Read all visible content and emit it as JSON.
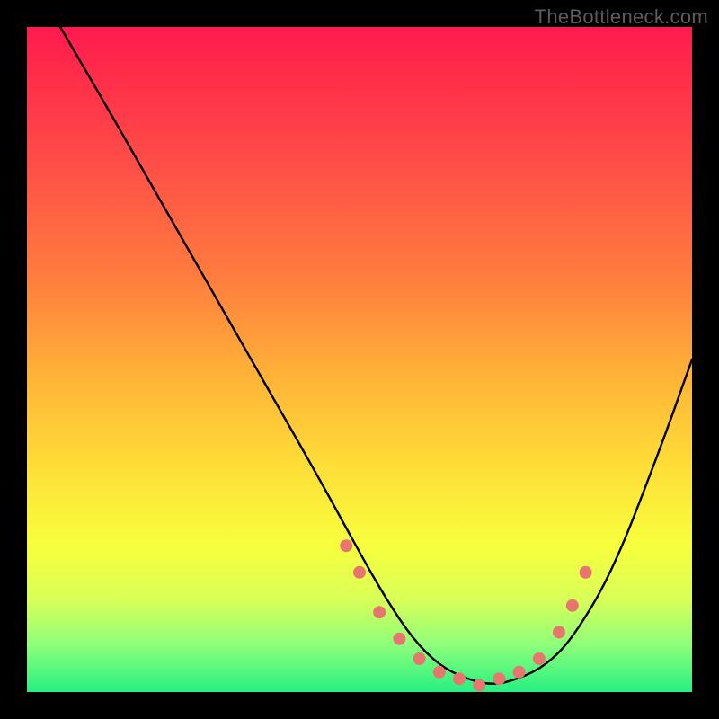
{
  "watermark": "TheBottleneck.com",
  "chart_data": {
    "type": "line",
    "title": "",
    "xlabel": "",
    "ylabel": "",
    "ylim": [
      0,
      100
    ],
    "xlim": [
      0,
      100
    ],
    "series": [
      {
        "name": "bottleneck-curve",
        "x": [
          5,
          12,
          20,
          28,
          36,
          44,
          50,
          54,
          58,
          62,
          66,
          70,
          74,
          78,
          82,
          88,
          95,
          100
        ],
        "y": [
          100,
          88,
          74,
          60,
          46,
          32,
          21,
          14,
          8,
          4,
          2,
          1,
          2,
          4,
          8,
          18,
          36,
          50
        ]
      }
    ],
    "markers": {
      "name": "highlight-dots",
      "x": [
        48,
        50,
        53,
        56,
        59,
        62,
        65,
        68,
        71,
        74,
        77,
        80,
        82,
        84
      ],
      "y": [
        22,
        18,
        12,
        8,
        5,
        3,
        2,
        1,
        2,
        3,
        5,
        9,
        13,
        18
      ]
    },
    "gradient_stops": [
      {
        "pos": 0,
        "color": "#ff1a4f"
      },
      {
        "pos": 18,
        "color": "#ff4748"
      },
      {
        "pos": 38,
        "color": "#ff7e3e"
      },
      {
        "pos": 66,
        "color": "#ffde38"
      },
      {
        "pos": 86,
        "color": "#d9ff57"
      },
      {
        "pos": 100,
        "color": "#26f081"
      }
    ],
    "note": "Axes are unlabeled in the source image; x and y expressed as 0–100 percent of the plot area. y=0 at bottom."
  }
}
